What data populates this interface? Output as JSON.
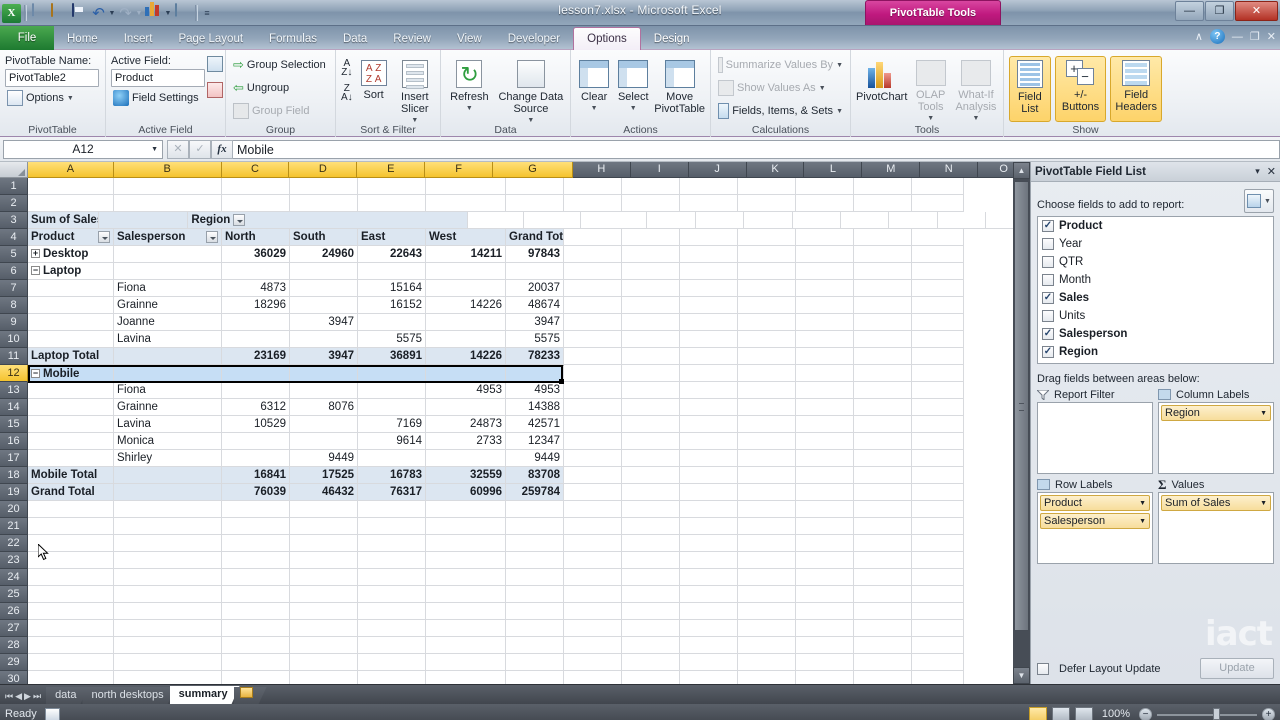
{
  "window": {
    "title": "lesson7.xlsx  -  Microsoft Excel",
    "contextual_banner": "PivotTable Tools",
    "minimize": "—",
    "restore": "❐",
    "close": "✕"
  },
  "qat": {
    "items": [
      {
        "name": "excel-logo-icon",
        "label": "X"
      },
      {
        "name": "new-icon",
        "label": ""
      },
      {
        "name": "open-icon",
        "label": ""
      },
      {
        "name": "save-icon",
        "label": ""
      },
      {
        "name": "undo-icon",
        "label": "↶"
      },
      {
        "name": "redo-icon",
        "label": "↷"
      },
      {
        "name": "chart-icon",
        "label": ""
      },
      {
        "name": "print-preview-icon",
        "label": ""
      },
      {
        "name": "customize-qat-icon",
        "label": "≡"
      }
    ]
  },
  "tabs": {
    "file": "File",
    "items": [
      "Home",
      "Insert",
      "Page Layout",
      "Formulas",
      "Data",
      "Review",
      "View",
      "Developer"
    ],
    "contextual": [
      {
        "label": "Options",
        "active": true
      },
      {
        "label": "Design",
        "active": false
      }
    ],
    "right_controls": {
      "collapse": "∧",
      "help": "?",
      "minimize": "—",
      "restore": "❐",
      "close": "✕"
    }
  },
  "ribbon": {
    "groups": [
      {
        "name": "pivottable",
        "label": "PivotTable",
        "fields": {
          "name_label": "PivotTable Name:",
          "name_value": "PivotTable2",
          "options_label": "Options"
        }
      },
      {
        "name": "active-field",
        "label": "Active Field",
        "fields": {
          "active_label": "Active Field:",
          "active_value": "Product",
          "field_settings": "Field Settings"
        }
      },
      {
        "name": "group",
        "label": "Group",
        "buttons": [
          {
            "label": "Group Selection",
            "disabled": false
          },
          {
            "label": "Ungroup",
            "disabled": false
          },
          {
            "label": "Group Field",
            "disabled": true
          }
        ]
      },
      {
        "name": "sort-filter",
        "label": "Sort & Filter",
        "buttons": [
          {
            "label": "Sort"
          },
          {
            "label": "Insert Slicer"
          }
        ]
      },
      {
        "name": "data",
        "label": "Data",
        "buttons": [
          {
            "label": "Refresh"
          },
          {
            "label": "Change Data Source"
          }
        ]
      },
      {
        "name": "actions",
        "label": "Actions",
        "buttons": [
          {
            "label": "Clear"
          },
          {
            "label": "Select"
          },
          {
            "label": "Move PivotTable"
          }
        ]
      },
      {
        "name": "calculations",
        "label": "Calculations",
        "buttons": [
          {
            "label": "Summarize Values By",
            "disabled": true
          },
          {
            "label": "Show Values As",
            "disabled": true
          },
          {
            "label": "Fields, Items, & Sets",
            "disabled": false
          }
        ]
      },
      {
        "name": "tools",
        "label": "Tools",
        "buttons": [
          {
            "label": "PivotChart",
            "disabled": false
          },
          {
            "label": "OLAP Tools",
            "disabled": true
          },
          {
            "label": "What-If Analysis",
            "disabled": true
          }
        ]
      },
      {
        "name": "show",
        "label": "Show",
        "buttons": [
          {
            "label": "Field List",
            "active": true
          },
          {
            "label": "+/- Buttons",
            "active": true
          },
          {
            "label": "Field Headers",
            "active": true
          }
        ]
      }
    ]
  },
  "formula_bar": {
    "name_box": "A12",
    "cancel": "✕",
    "enter": "✓",
    "fx": "fx",
    "value": "Mobile"
  },
  "grid": {
    "columns": [
      "A",
      "B",
      "C",
      "D",
      "E",
      "F",
      "G",
      "H",
      "I",
      "J",
      "K",
      "L",
      "M",
      "N",
      "O"
    ],
    "selected_columns": [
      "A",
      "B",
      "C",
      "D",
      "E",
      "F",
      "G"
    ],
    "rows": [
      1,
      2,
      3,
      4,
      5,
      6,
      7,
      8,
      9,
      10,
      11,
      12,
      13,
      14,
      15,
      16,
      17,
      18,
      19,
      20,
      21,
      22,
      23,
      24,
      25,
      26,
      27,
      28,
      29,
      30
    ],
    "selected_row": 12,
    "selected_cell": "A12"
  },
  "pivot": {
    "title": "Sum of Sales",
    "column_field": "Region",
    "row_field_1": "Product",
    "row_field_2": "Salesperson",
    "column_headers": [
      "North",
      "South",
      "East",
      "West",
      "Grand Total"
    ],
    "rows": [
      {
        "row": 5,
        "type": "product",
        "expander": "+",
        "label": "Desktop",
        "person": "",
        "values": [
          "36029",
          "24960",
          "22643",
          "14211",
          "97843"
        ]
      },
      {
        "row": 6,
        "type": "product",
        "expander": "−",
        "label": "Laptop",
        "person": "",
        "values": [
          "",
          "",
          "",
          "",
          ""
        ]
      },
      {
        "row": 7,
        "type": "person",
        "expander": "",
        "label": "",
        "person": "Fiona",
        "values": [
          "4873",
          "",
          "15164",
          "",
          "20037"
        ]
      },
      {
        "row": 8,
        "type": "person",
        "expander": "",
        "label": "",
        "person": "Grainne",
        "values": [
          "18296",
          "",
          "16152",
          "14226",
          "48674"
        ]
      },
      {
        "row": 9,
        "type": "person",
        "expander": "",
        "label": "",
        "person": "Joanne",
        "values": [
          "",
          "3947",
          "",
          "",
          "3947"
        ]
      },
      {
        "row": 10,
        "type": "person",
        "expander": "",
        "label": "",
        "person": "Lavina",
        "values": [
          "",
          "",
          "5575",
          "",
          "5575"
        ]
      },
      {
        "row": 11,
        "type": "subtotal",
        "expander": "",
        "label": "Laptop Total",
        "person": "",
        "values": [
          "23169",
          "3947",
          "36891",
          "14226",
          "78233"
        ]
      },
      {
        "row": 12,
        "type": "product",
        "expander": "−",
        "label": "Mobile",
        "person": "",
        "values": [
          "",
          "",
          "",
          "",
          ""
        ]
      },
      {
        "row": 13,
        "type": "person",
        "expander": "",
        "label": "",
        "person": "Fiona",
        "values": [
          "",
          "",
          "",
          "4953",
          "4953"
        ]
      },
      {
        "row": 14,
        "type": "person",
        "expander": "",
        "label": "",
        "person": "Grainne",
        "values": [
          "6312",
          "8076",
          "",
          "",
          "14388"
        ]
      },
      {
        "row": 15,
        "type": "person",
        "expander": "",
        "label": "",
        "person": "Lavina",
        "values": [
          "10529",
          "",
          "7169",
          "24873",
          "42571"
        ]
      },
      {
        "row": 16,
        "type": "person",
        "expander": "",
        "label": "",
        "person": "Monica",
        "values": [
          "",
          "",
          "9614",
          "2733",
          "12347"
        ]
      },
      {
        "row": 17,
        "type": "person",
        "expander": "",
        "label": "",
        "person": "Shirley",
        "values": [
          "",
          "9449",
          "",
          "",
          "9449"
        ]
      },
      {
        "row": 18,
        "type": "subtotal",
        "expander": "",
        "label": "Mobile Total",
        "person": "",
        "values": [
          "16841",
          "17525",
          "16783",
          "32559",
          "83708"
        ]
      },
      {
        "row": 19,
        "type": "grand",
        "expander": "",
        "label": "Grand Total",
        "person": "",
        "values": [
          "76039",
          "46432",
          "76317",
          "60996",
          "259784"
        ]
      }
    ]
  },
  "field_list": {
    "title": "PivotTable Field List",
    "minimize": "▾",
    "close": "✕",
    "choose_label": "Choose fields to add to report:",
    "view_button": "view-options-icon",
    "fields": [
      {
        "label": "Product",
        "checked": true
      },
      {
        "label": "Year",
        "checked": false
      },
      {
        "label": "QTR",
        "checked": false
      },
      {
        "label": "Month",
        "checked": false
      },
      {
        "label": "Sales",
        "checked": true
      },
      {
        "label": "Units",
        "checked": false
      },
      {
        "label": "Salesperson",
        "checked": true
      },
      {
        "label": "Region",
        "checked": true
      }
    ],
    "drag_label": "Drag fields between areas below:",
    "zones": [
      {
        "name": "report-filter",
        "title": "Report Filter",
        "chips": []
      },
      {
        "name": "column-labels",
        "title": "Column Labels",
        "chips": [
          "Region"
        ]
      },
      {
        "name": "row-labels",
        "title": "Row Labels",
        "chips": [
          "Product",
          "Salesperson"
        ]
      },
      {
        "name": "values",
        "title": "Values",
        "chips": [
          "Sum of Sales"
        ],
        "sigma": "Σ"
      }
    ],
    "defer_label": "Defer Layout Update",
    "update_button": "Update",
    "watermark": "iact"
  },
  "sheet_tabs": {
    "nav": [
      "⏮",
      "◀",
      "▶",
      "⏭"
    ],
    "items": [
      {
        "label": "data",
        "active": false
      },
      {
        "label": "north desktops",
        "active": false
      },
      {
        "label": "summary",
        "active": true
      }
    ],
    "new_sheet": "new-sheet-icon"
  },
  "status_bar": {
    "status": "Ready",
    "record_macro": "record-macro-icon",
    "views": [
      "normal-view",
      "page-layout-view",
      "page-break-view"
    ],
    "zoom": "100%",
    "zoom_out": "−",
    "zoom_in": "+"
  }
}
